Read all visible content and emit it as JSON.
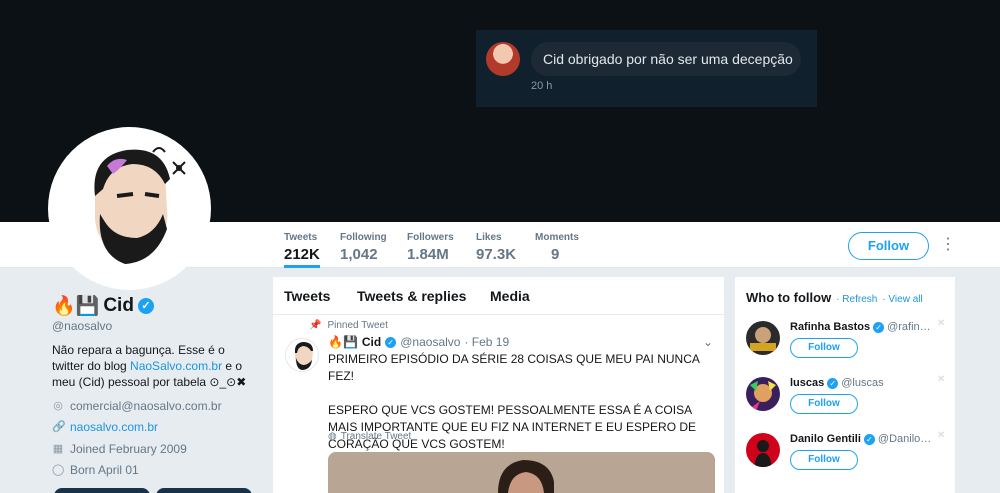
{
  "dm": {
    "message": "Cid obrigado por não ser uma decepção",
    "time": "20 h"
  },
  "nav": {
    "stats": [
      {
        "label": "Tweets",
        "value": "212K"
      },
      {
        "label": "Following",
        "value": "1,042"
      },
      {
        "label": "Followers",
        "value": "1.84M"
      },
      {
        "label": "Likes",
        "value": "97.3K"
      },
      {
        "label": "Moments",
        "value": "9"
      }
    ],
    "follow_label": "Follow",
    "more_glyph": "⋮"
  },
  "profile": {
    "emoji_prefix": "🔥💾",
    "name": "Cid",
    "handle": "@naosalvo",
    "bio_1": "Não repara a bagunça. Esse é o twitter do blog ",
    "bio_link": "NaoSalvo.com.br",
    "bio_2": " e o meu (Cid) pessoal por tabela ⊙_⊙✖",
    "email": "comercial@naosalvo.com.br",
    "website": "naosalvo.com.br",
    "joined": "Joined February 2009",
    "born": "Born April 01"
  },
  "timeline": {
    "tabs": [
      "Tweets",
      "Tweets & replies",
      "Media"
    ],
    "pinned_label": "Pinned Tweet",
    "tweet": {
      "emoji_prefix": "🔥💾",
      "name": "Cid",
      "handle": "@naosalvo",
      "date": "· Feb 19",
      "line1": "PRIMEIRO EPISÓDIO DA SÉRIE 28 COISAS QUE MEU PAI NUNCA FEZ!",
      "line2": "ESPERO QUE VCS GOSTEM! PESSOALMENTE ESSA É A COISA MAIS IMPORTANTE QUE EU FIZ NA INTERNET E EU ESPERO DE CORAÇÃO QUE VCS GOSTEM!",
      "translate": "Translate Tweet"
    }
  },
  "who_to_follow": {
    "title": "Who to follow",
    "refresh": "· Refresh",
    "view_all": "· View all",
    "follow_label": "Follow",
    "suggestions": [
      {
        "name": "Rafinha Bastos",
        "handle": "@rafin…"
      },
      {
        "name": "luscas",
        "handle": "@luscas"
      },
      {
        "name": "Danilo Gentili",
        "handle": "@Danilo…"
      }
    ]
  },
  "colors": {
    "accent": "#1da1f2",
    "banner": "#0b1114",
    "link": "#1b95e0"
  }
}
